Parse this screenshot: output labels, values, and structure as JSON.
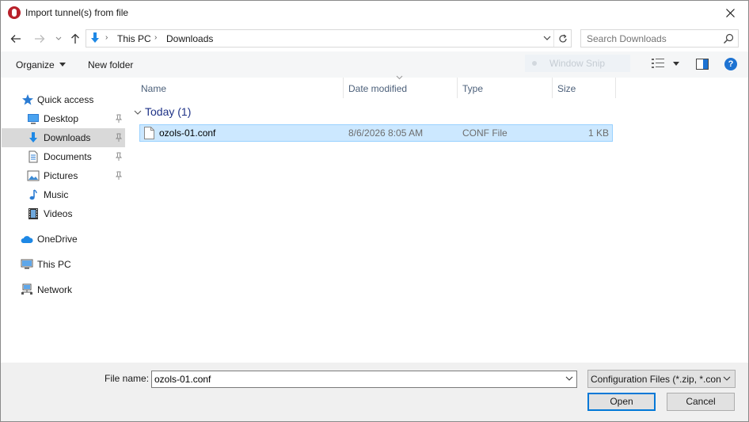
{
  "window": {
    "title": "Import tunnel(s) from file"
  },
  "address": {
    "breadcrumbs": [
      "This PC",
      "Downloads"
    ]
  },
  "search": {
    "placeholder": "Search Downloads"
  },
  "toolbar": {
    "organize_label": "Organize",
    "new_folder_label": "New folder",
    "ghost_overlay_label": "Window Snip"
  },
  "sidebar": {
    "items": [
      {
        "label": "Quick access",
        "icon": "star-icon"
      },
      {
        "label": "Desktop",
        "icon": "desktop-icon",
        "pinned": true
      },
      {
        "label": "Downloads",
        "icon": "download-arrow-icon",
        "pinned": true,
        "selected": true
      },
      {
        "label": "Documents",
        "icon": "document-icon",
        "pinned": true
      },
      {
        "label": "Pictures",
        "icon": "picture-icon",
        "pinned": true
      },
      {
        "label": "Music",
        "icon": "music-note-icon"
      },
      {
        "label": "Videos",
        "icon": "film-icon"
      },
      {
        "label": "OneDrive",
        "icon": "cloud-icon"
      },
      {
        "label": "This PC",
        "icon": "computer-icon"
      },
      {
        "label": "Network",
        "icon": "network-icon"
      }
    ]
  },
  "filelist": {
    "columns": [
      "Name",
      "Date modified",
      "Type",
      "Size"
    ],
    "group_label": "Today (1)",
    "rows": [
      {
        "name": "ozols-01.conf",
        "date": "8/6/2026 8:05 AM",
        "type": "CONF File",
        "size": "1 KB"
      }
    ]
  },
  "footer": {
    "file_name_label": "File name:",
    "file_name_value": "ozols-01.conf",
    "file_type": "Configuration Files (*.zip, *.con",
    "open_label": "Open",
    "cancel_label": "Cancel"
  },
  "colors": {
    "accent": "#0078d7",
    "selection": "#cce8ff",
    "group_header": "#1e3287"
  }
}
